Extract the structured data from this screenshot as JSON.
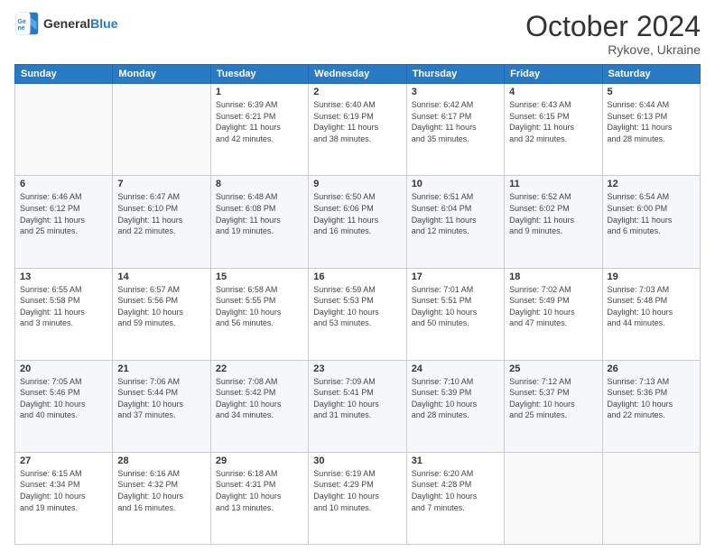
{
  "logo": {
    "line1": "General",
    "line2": "Blue"
  },
  "title": "October 2024",
  "subtitle": "Rykove, Ukraine",
  "days_of_week": [
    "Sunday",
    "Monday",
    "Tuesday",
    "Wednesday",
    "Thursday",
    "Friday",
    "Saturday"
  ],
  "weeks": [
    [
      {
        "day": "",
        "info": ""
      },
      {
        "day": "",
        "info": ""
      },
      {
        "day": "1",
        "info": "Sunrise: 6:39 AM\nSunset: 6:21 PM\nDaylight: 11 hours\nand 42 minutes."
      },
      {
        "day": "2",
        "info": "Sunrise: 6:40 AM\nSunset: 6:19 PM\nDaylight: 11 hours\nand 38 minutes."
      },
      {
        "day": "3",
        "info": "Sunrise: 6:42 AM\nSunset: 6:17 PM\nDaylight: 11 hours\nand 35 minutes."
      },
      {
        "day": "4",
        "info": "Sunrise: 6:43 AM\nSunset: 6:15 PM\nDaylight: 11 hours\nand 32 minutes."
      },
      {
        "day": "5",
        "info": "Sunrise: 6:44 AM\nSunset: 6:13 PM\nDaylight: 11 hours\nand 28 minutes."
      }
    ],
    [
      {
        "day": "6",
        "info": "Sunrise: 6:46 AM\nSunset: 6:12 PM\nDaylight: 11 hours\nand 25 minutes."
      },
      {
        "day": "7",
        "info": "Sunrise: 6:47 AM\nSunset: 6:10 PM\nDaylight: 11 hours\nand 22 minutes."
      },
      {
        "day": "8",
        "info": "Sunrise: 6:48 AM\nSunset: 6:08 PM\nDaylight: 11 hours\nand 19 minutes."
      },
      {
        "day": "9",
        "info": "Sunrise: 6:50 AM\nSunset: 6:06 PM\nDaylight: 11 hours\nand 16 minutes."
      },
      {
        "day": "10",
        "info": "Sunrise: 6:51 AM\nSunset: 6:04 PM\nDaylight: 11 hours\nand 12 minutes."
      },
      {
        "day": "11",
        "info": "Sunrise: 6:52 AM\nSunset: 6:02 PM\nDaylight: 11 hours\nand 9 minutes."
      },
      {
        "day": "12",
        "info": "Sunrise: 6:54 AM\nSunset: 6:00 PM\nDaylight: 11 hours\nand 6 minutes."
      }
    ],
    [
      {
        "day": "13",
        "info": "Sunrise: 6:55 AM\nSunset: 5:58 PM\nDaylight: 11 hours\nand 3 minutes."
      },
      {
        "day": "14",
        "info": "Sunrise: 6:57 AM\nSunset: 5:56 PM\nDaylight: 10 hours\nand 59 minutes."
      },
      {
        "day": "15",
        "info": "Sunrise: 6:58 AM\nSunset: 5:55 PM\nDaylight: 10 hours\nand 56 minutes."
      },
      {
        "day": "16",
        "info": "Sunrise: 6:59 AM\nSunset: 5:53 PM\nDaylight: 10 hours\nand 53 minutes."
      },
      {
        "day": "17",
        "info": "Sunrise: 7:01 AM\nSunset: 5:51 PM\nDaylight: 10 hours\nand 50 minutes."
      },
      {
        "day": "18",
        "info": "Sunrise: 7:02 AM\nSunset: 5:49 PM\nDaylight: 10 hours\nand 47 minutes."
      },
      {
        "day": "19",
        "info": "Sunrise: 7:03 AM\nSunset: 5:48 PM\nDaylight: 10 hours\nand 44 minutes."
      }
    ],
    [
      {
        "day": "20",
        "info": "Sunrise: 7:05 AM\nSunset: 5:46 PM\nDaylight: 10 hours\nand 40 minutes."
      },
      {
        "day": "21",
        "info": "Sunrise: 7:06 AM\nSunset: 5:44 PM\nDaylight: 10 hours\nand 37 minutes."
      },
      {
        "day": "22",
        "info": "Sunrise: 7:08 AM\nSunset: 5:42 PM\nDaylight: 10 hours\nand 34 minutes."
      },
      {
        "day": "23",
        "info": "Sunrise: 7:09 AM\nSunset: 5:41 PM\nDaylight: 10 hours\nand 31 minutes."
      },
      {
        "day": "24",
        "info": "Sunrise: 7:10 AM\nSunset: 5:39 PM\nDaylight: 10 hours\nand 28 minutes."
      },
      {
        "day": "25",
        "info": "Sunrise: 7:12 AM\nSunset: 5:37 PM\nDaylight: 10 hours\nand 25 minutes."
      },
      {
        "day": "26",
        "info": "Sunrise: 7:13 AM\nSunset: 5:36 PM\nDaylight: 10 hours\nand 22 minutes."
      }
    ],
    [
      {
        "day": "27",
        "info": "Sunrise: 6:15 AM\nSunset: 4:34 PM\nDaylight: 10 hours\nand 19 minutes."
      },
      {
        "day": "28",
        "info": "Sunrise: 6:16 AM\nSunset: 4:32 PM\nDaylight: 10 hours\nand 16 minutes."
      },
      {
        "day": "29",
        "info": "Sunrise: 6:18 AM\nSunset: 4:31 PM\nDaylight: 10 hours\nand 13 minutes."
      },
      {
        "day": "30",
        "info": "Sunrise: 6:19 AM\nSunset: 4:29 PM\nDaylight: 10 hours\nand 10 minutes."
      },
      {
        "day": "31",
        "info": "Sunrise: 6:20 AM\nSunset: 4:28 PM\nDaylight: 10 hours\nand 7 minutes."
      },
      {
        "day": "",
        "info": ""
      },
      {
        "day": "",
        "info": ""
      }
    ]
  ]
}
